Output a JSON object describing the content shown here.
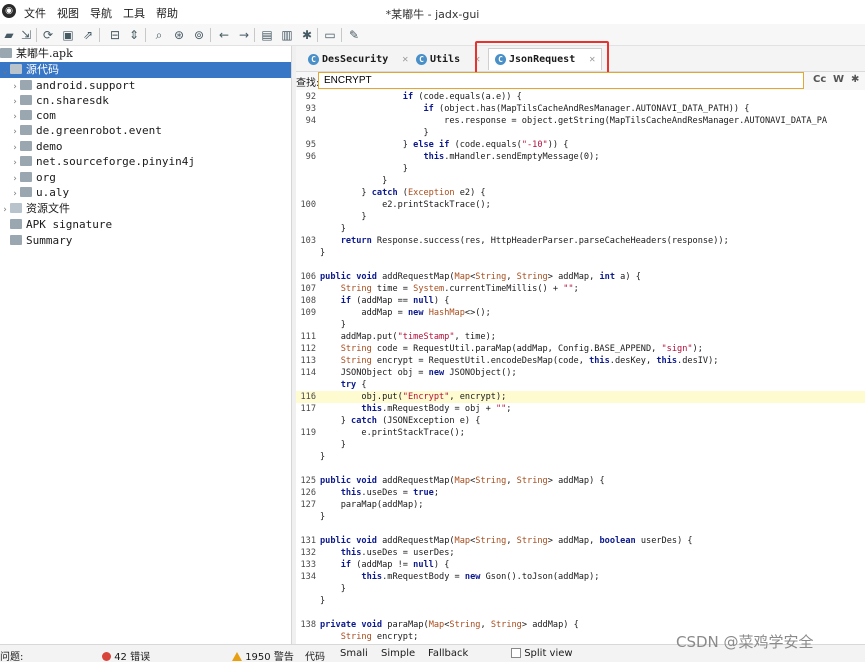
{
  "app": {
    "window_title": "*某嘟牛 - jadx-gui",
    "menu": [
      "文件",
      "视图",
      "导航",
      "工具",
      "帮助"
    ]
  },
  "toolbar": {
    "icons": [
      "open-icon",
      "save-all-icon",
      "sync-icon",
      "save-icon",
      "export-icon",
      "flatten-icon",
      "expand-icon",
      "search-icon",
      "find-class-icon",
      "find-usage-icon",
      "back-icon",
      "forward-icon",
      "deobfuscation-icon",
      "log-icon",
      "debug-icon",
      "preferences-icon",
      "wrench-icon"
    ]
  },
  "tree": {
    "root": "某嘟牛.apk",
    "source_label": "源代码",
    "packages": [
      "android.support",
      "cn.sharesdk",
      "com",
      "de.greenrobot.event",
      "demo",
      "net.sourceforge.pinyin4j",
      "org",
      "u.aly"
    ],
    "resources_label": "资源文件",
    "signature_label": "APK signature",
    "summary_label": "Summary"
  },
  "tabs": [
    {
      "label": "DesSecurity",
      "active": false
    },
    {
      "label": "Utils",
      "active": false
    },
    {
      "label": "JsonRequest",
      "active": true
    }
  ],
  "search": {
    "label": "查找:",
    "value": "ENCRYPT",
    "opt_case": "Cc",
    "opt_word": "W"
  },
  "code": [
    {
      "n": "92",
      "t": "                if (code.equals(a.e)) {",
      "hl": false
    },
    {
      "n": "93",
      "t": "                    if (object.has(MapTilsCacheAndResManager.AUTONAVI_DATA_PATH)) {",
      "hl": false
    },
    {
      "n": "94",
      "t": "                        res.response = object.getString(MapTilsCacheAndResManager.AUTONAVI_DATA_PA",
      "hl": false
    },
    {
      "n": "",
      "t": "                    }",
      "hl": false
    },
    {
      "n": "95",
      "t": "                } else if (code.equals(\"-10\")) {",
      "hl": false
    },
    {
      "n": "96",
      "t": "                    this.mHandler.sendEmptyMessage(0);",
      "hl": false
    },
    {
      "n": "",
      "t": "                }",
      "hl": false
    },
    {
      "n": "",
      "t": "            }",
      "hl": false
    },
    {
      "n": "",
      "t": "        } catch (Exception e2) {",
      "hl": false
    },
    {
      "n": "100",
      "t": "            e2.printStackTrace();",
      "hl": false
    },
    {
      "n": "",
      "t": "        }",
      "hl": false
    },
    {
      "n": "",
      "t": "    }",
      "hl": false
    },
    {
      "n": "103",
      "t": "    return Response.success(res, HttpHeaderParser.parseCacheHeaders(response));",
      "hl": false
    },
    {
      "n": "",
      "t": "}",
      "hl": false
    },
    {
      "n": "",
      "t": "",
      "hl": false
    },
    {
      "n": "106",
      "t": "public void addRequestMap(Map<String, String> addMap, int a) {",
      "hl": false
    },
    {
      "n": "107",
      "t": "    String time = System.currentTimeMillis() + \"\";",
      "hl": false
    },
    {
      "n": "108",
      "t": "    if (addMap == null) {",
      "hl": false
    },
    {
      "n": "109",
      "t": "        addMap = new HashMap<>();",
      "hl": false
    },
    {
      "n": "",
      "t": "    }",
      "hl": false
    },
    {
      "n": "111",
      "t": "    addMap.put(\"timeStamp\", time);",
      "hl": false
    },
    {
      "n": "112",
      "t": "    String code = RequestUtil.paraMap(addMap, Config.BASE_APPEND, \"sign\");",
      "hl": false
    },
    {
      "n": "113",
      "t": "    String encrypt = RequestUtil.encodeDesMap(code, this.desKey, this.desIV);",
      "hl": false
    },
    {
      "n": "114",
      "t": "    JSONObject obj = new JSONObject();",
      "hl": false
    },
    {
      "n": "",
      "t": "    try {",
      "hl": false
    },
    {
      "n": "116",
      "t": "        obj.put(\"Encrypt\", encrypt);",
      "hl": true
    },
    {
      "n": "117",
      "t": "        this.mRequestBody = obj + \"\";",
      "hl": false
    },
    {
      "n": "",
      "t": "    } catch (JSONException e) {",
      "hl": false
    },
    {
      "n": "119",
      "t": "        e.printStackTrace();",
      "hl": false
    },
    {
      "n": "",
      "t": "    }",
      "hl": false
    },
    {
      "n": "",
      "t": "}",
      "hl": false
    },
    {
      "n": "",
      "t": "",
      "hl": false
    },
    {
      "n": "125",
      "t": "public void addRequestMap(Map<String, String> addMap) {",
      "hl": false
    },
    {
      "n": "126",
      "t": "    this.useDes = true;",
      "hl": false
    },
    {
      "n": "127",
      "t": "    paraMap(addMap);",
      "hl": false
    },
    {
      "n": "",
      "t": "}",
      "hl": false
    },
    {
      "n": "",
      "t": "",
      "hl": false
    },
    {
      "n": "131",
      "t": "public void addRequestMap(Map<String, String> addMap, boolean userDes) {",
      "hl": false
    },
    {
      "n": "132",
      "t": "    this.useDes = userDes;",
      "hl": false
    },
    {
      "n": "133",
      "t": "    if (addMap != null) {",
      "hl": false
    },
    {
      "n": "134",
      "t": "        this.mRequestBody = new Gson().toJson(addMap);",
      "hl": false
    },
    {
      "n": "",
      "t": "    }",
      "hl": false
    },
    {
      "n": "",
      "t": "}",
      "hl": false
    },
    {
      "n": "",
      "t": "",
      "hl": false
    },
    {
      "n": "138",
      "t": "private void paraMap(Map<String, String> addMap) {",
      "hl": false
    },
    {
      "n": "",
      "t": "    String encrypt;",
      "hl": false
    }
  ],
  "status": {
    "issues_label": "问题:",
    "errors": "42 错误",
    "warnings": "1950 警告",
    "view_tabs": [
      "代码",
      "Smali",
      "Simple",
      "Fallback"
    ],
    "split_view": "Split view",
    "watermark": "CSDN @菜鸡学安全"
  },
  "colors": {
    "selection": "#3876c6",
    "highlight_box": "#e8322d",
    "line_highlight": "#fdfbcf",
    "keyword": "#0d1a8d",
    "string": "#b30f3a"
  }
}
